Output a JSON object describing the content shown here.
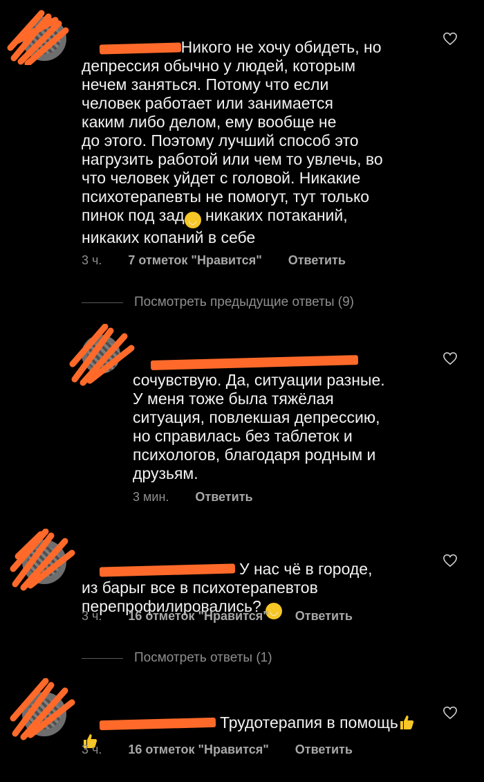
{
  "comments": [
    {
      "text_lines": [
        "Никого не хочу обидеть, но",
        "депрессия обычно у людей, которым",
        "нечем заняться. Потому что если",
        "человек работает или занимается",
        "каким либо делом, ему вообще не",
        "до этого. Поэтому лучший способ это",
        "нагрузить работой или чем то увлечь, во",
        "что человек уйдет с головой. Никакие",
        "психотерапевты не помогут, тут только",
        "пинок под зад",
        " никаких потаканий,",
        "никаких копаний в себе"
      ],
      "time": "3 ч.",
      "likes": "7 отметок \"Нравится\"",
      "reply": "Ответить"
    },
    {
      "view_replies": "Посмотреть предыдущие ответы (9)"
    },
    {
      "text_lines": [
        "сочувствую. Да, ситуации разные.",
        "У меня тоже была тяжёлая",
        "ситуация, повлекшая депрессию,",
        "но справилась без таблеток и",
        "психологов, благодаря родным и",
        "друзьям."
      ],
      "time": "3 мин.",
      "reply": "Ответить"
    },
    {
      "text_lines": [
        "У нас чё в городе,",
        "из барыг все в психотерапевтов",
        "перепрофилировались?"
      ],
      "time": "3 ч.",
      "likes": "16 отметок \"Нравится\"",
      "reply": "Ответить"
    },
    {
      "view_replies": "Посмотреть ответы (1)"
    },
    {
      "text_lines": [
        "Трудотерапия в помощь"
      ],
      "time": "3 ч.",
      "likes": "16 отметок \"Нравится\"",
      "reply": "Ответить"
    }
  ],
  "colors": {
    "background": "#000000",
    "text": "#f2f2f2",
    "muted": "#8e8e8e",
    "redaction": "#ff6a2a"
  }
}
